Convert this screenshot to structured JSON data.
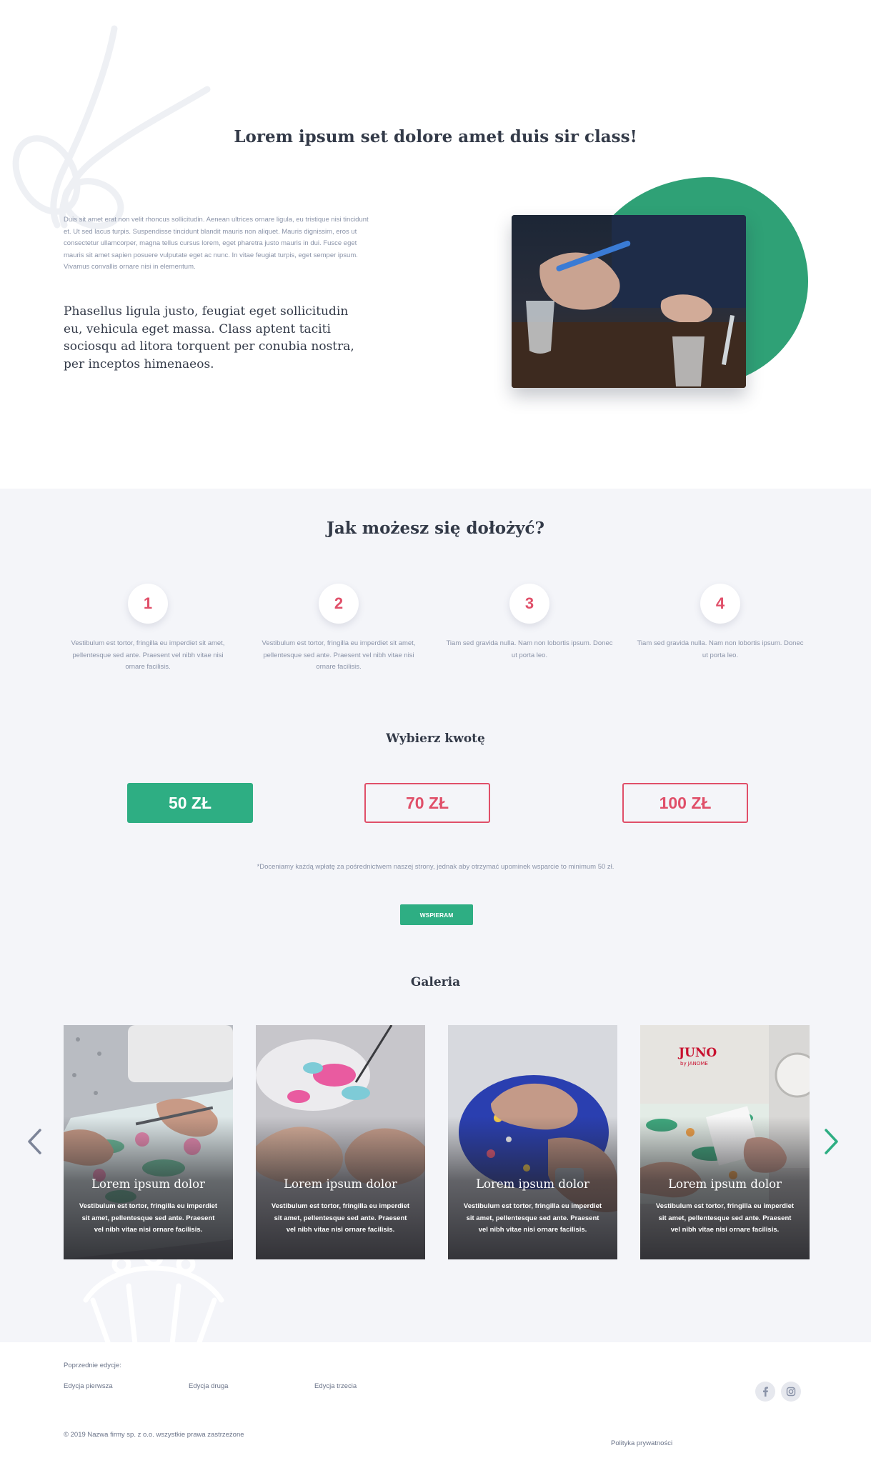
{
  "intro": {
    "title": "Lorem ipsum set dolore amet duis sir class!",
    "paragraph_small": "Duis sit amet erat non velit rhoncus sollicitudin. Aenean ultrices ornare ligula, eu tristique nisi tincidunt et. Ut sed lacus turpis. Suspendisse tincidunt blandit mauris non aliquet. Mauris dignissim, eros ut consectetur ullamcorper, magna tellus cursus lorem, eget pharetra justo mauris in dui. Fusce eget mauris sit amet sapien posuere vulputate eget ac nunc. In vitae feugiat turpis, eget semper ipsum. Vivamus convallis ornare nisi in elementum.",
    "paragraph_large": "Phasellus ligula justo, feugiat eget sollicitudin eu, vehicula eget massa. Class aptent taciti sociosqu ad litora torquent per conubia nostra, per inceptos himenaeos.",
    "accent_color": "#2fa176"
  },
  "how": {
    "title": "Jak możesz się dołożyć?",
    "steps": [
      {
        "number": "1",
        "text": "Vestibulum est tortor, fringilla eu imperdiet sit amet, pellentesque sed ante. Praesent vel nibh vitae nisi ornare facilisis."
      },
      {
        "number": "2",
        "text": "Vestibulum est tortor, fringilla eu imperdiet sit amet, pellentesque sed ante. Praesent vel nibh vitae nisi ornare facilisis."
      },
      {
        "number": "3",
        "text": "Tiam sed gravida nulla. Nam non lobortis ipsum. Donec ut porta leo."
      },
      {
        "number": "4",
        "text": "Tiam sed gravida nulla. Nam non lobortis ipsum. Donec ut porta leo."
      }
    ]
  },
  "donation": {
    "title": "Wybierz kwotę",
    "amounts": [
      "50 ZŁ",
      "70 ZŁ",
      "100 ZŁ"
    ],
    "selected": "50 ZŁ",
    "note": "*Doceniamy każdą wpłatę za pośrednictwem naszej strony, jednak aby otrzymać upominek wsparcie to minimum 50 zł.",
    "button_label": "WSPIERAM",
    "colors": {
      "green": "#2eae83",
      "pink": "#e04f69"
    }
  },
  "gallery": {
    "title": "Galeria",
    "cards": [
      {
        "title": "Lorem ipsum dolor",
        "text": "Vestibulum est tortor, fringilla eu imperdiet sit amet, pellentesque sed ante. Praesent vel nibh vitae nisi ornare facilisis."
      },
      {
        "title": "Lorem ipsum dolor",
        "text": "Vestibulum est tortor, fringilla eu imperdiet sit amet, pellentesque sed ante. Praesent vel nibh vitae nisi ornare facilisis."
      },
      {
        "title": "Lorem ipsum dolor",
        "text": "Vestibulum est tortor, fringilla eu imperdiet sit amet, pellentesque sed ante. Praesent vel nibh vitae nisi ornare facilisis."
      },
      {
        "title": "Lorem ipsum dolor",
        "text": "Vestibulum est tortor, fringilla eu imperdiet sit amet, pellentesque sed ante. Praesent vel nibh vitae nisi ornare facilisis."
      }
    ],
    "machine_brand": "JUNO",
    "machine_sub": "by JANOME",
    "arrows": {
      "prev_icon": "chevron-left-icon",
      "next_icon": "chevron-right-icon"
    }
  },
  "footer": {
    "previous_label": "Poprzednie edycje:",
    "links": [
      "Edycja pierwsza",
      "Edycja druga",
      "Edycja trzecia"
    ],
    "copyright": "© 2019 Nazwa firmy sp. z o.o. wszystkie prawa zastrzeżone",
    "privacy": "Polityka prywatności",
    "social": [
      "facebook-icon",
      "instagram-icon"
    ]
  }
}
